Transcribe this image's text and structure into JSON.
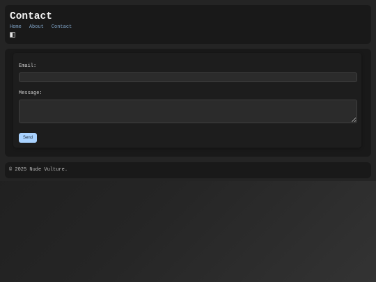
{
  "header": {
    "title": "Contact",
    "nav": [
      {
        "label": "Home"
      },
      {
        "label": "About"
      },
      {
        "label": "Contact"
      }
    ],
    "theme_toggle_icon": "contrast-toggle-icon"
  },
  "form": {
    "email_label": "Email:",
    "email_value": "",
    "message_label": "Message:",
    "message_value": "",
    "send_label": "Send"
  },
  "footer": {
    "text": "© 2025 Nude Vulture."
  },
  "colors": {
    "page_background": "#242424",
    "card_background": "#191919",
    "link": "#7fa3c7",
    "button": "#a9d2ff"
  }
}
